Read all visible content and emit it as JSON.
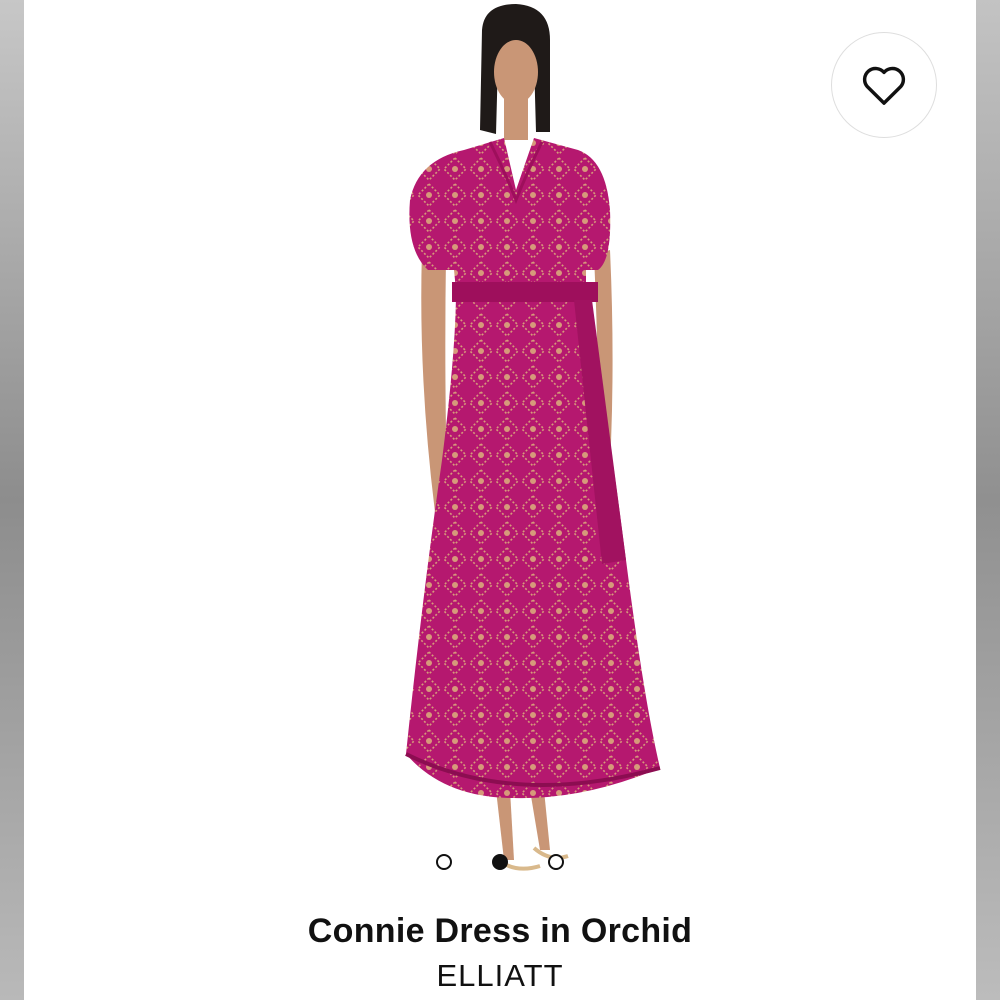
{
  "product": {
    "name": "Connie Dress in Orchid",
    "brand": "ELLIATT",
    "dress_color": "#b5186f"
  },
  "carousel": {
    "image_count": 3,
    "active_index": 1
  },
  "icons": {
    "favorite": "heart-outline-icon"
  }
}
